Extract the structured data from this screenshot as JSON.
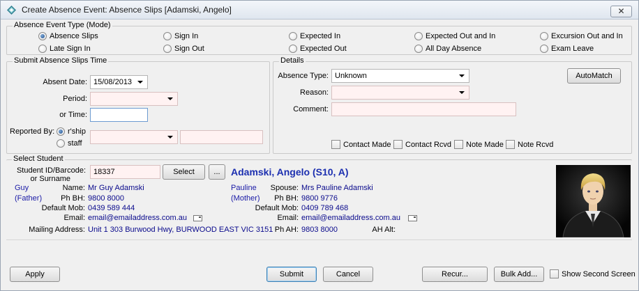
{
  "window": {
    "title": "Create Absence Event: Absence Slips [Adamski, Angelo]",
    "close_glyph": "✕"
  },
  "mode": {
    "title": "Absence Event Type (Mode)",
    "options": [
      "Absence Slips",
      "Sign In",
      "Expected In",
      "Expected Out and In",
      "Excursion Out and In",
      "Late Sign In",
      "Sign Out",
      "Expected Out",
      "All Day Absence",
      "Exam Leave"
    ],
    "selected": "Absence Slips"
  },
  "submit_time": {
    "title": "Submit Absence Slips Time",
    "absent_date_label": "Absent Date:",
    "absent_date_value": "15/08/2013",
    "period_label": "Period:",
    "period_value": "",
    "or_time_label": "or Time:",
    "or_time_value": "",
    "reported_by_label": "Reported By:",
    "reported_options": [
      "r'ship",
      "staff"
    ],
    "reported_selected": "r'ship",
    "reporter_value": "",
    "reporter_extra": ""
  },
  "details": {
    "title": "Details",
    "absence_type_label": "Absence Type:",
    "absence_type_value": "Unknown",
    "reason_label": "Reason:",
    "reason_value": "",
    "comment_label": "Comment:",
    "comment_value": "",
    "automatch_label": "AutoMatch",
    "checks": [
      "Contact Made",
      "Contact Rcvd",
      "Note Made",
      "Note Rcvd"
    ]
  },
  "student": {
    "title": "Select Student",
    "id_label_1": "Student ID/Barcode:",
    "id_label_2": "or Surname",
    "id_value": "18337",
    "select_label": "Select",
    "more_label": "...",
    "name_display": "Adamski, Angelo (S10, A)",
    "father": {
      "first": "Guy",
      "role": "(Father)",
      "name_label": "Name:",
      "name": "Mr Guy Adamski",
      "phbh_label": "Ph BH:",
      "phbh": "9800 8000",
      "mob_label": "Default Mob:",
      "mob": "0439 589 444",
      "email_label": "Email:",
      "email": "email@emailaddress.com.au"
    },
    "mother": {
      "first": "Pauline",
      "role": "(Mother)",
      "name_label": "Spouse:",
      "name": "Mrs Pauline Adamski",
      "phbh_label": "Ph BH:",
      "phbh": "9800 9776",
      "mob_label": "Default Mob:",
      "mob": "0409 789 468",
      "email_label": "Email:",
      "email": "email@emailaddress.com.au"
    },
    "mailing_label": "Mailing Address:",
    "mailing_value": "Unit 1 303 Burwood Hwy, BURWOOD EAST VIC 3151",
    "ph_ah_label": "Ph AH:",
    "ph_ah_value": "9803 8000",
    "ah_alt_label": "AH Alt:",
    "ah_alt_value": ""
  },
  "footer": {
    "apply": "Apply",
    "submit": "Submit",
    "cancel": "Cancel",
    "recur": "Recur...",
    "bulk_add": "Bulk Add...",
    "show_second_screen": "Show Second Screen"
  }
}
